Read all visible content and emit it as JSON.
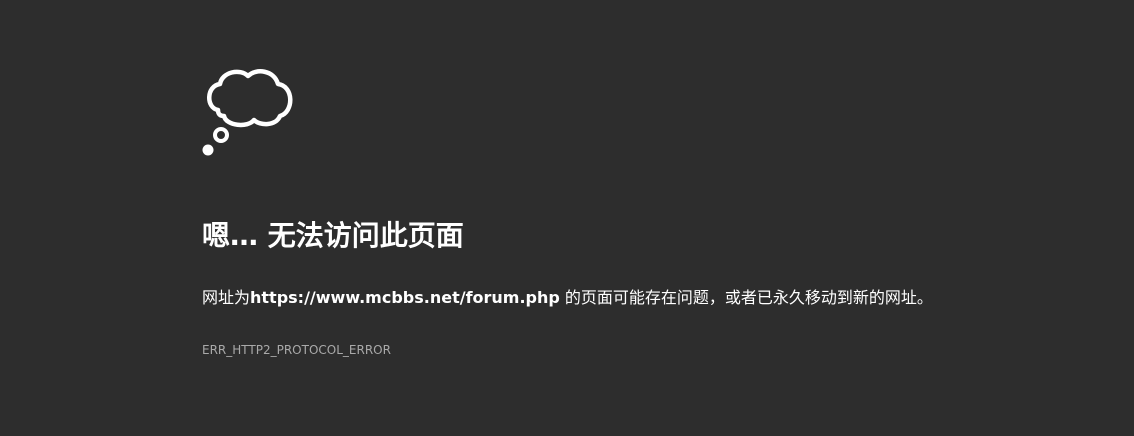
{
  "icon": "thought-cloud-icon",
  "colors": {
    "background": "#2d2d2d",
    "text": "#ffffff",
    "code_text": "#a9a9a9"
  },
  "error": {
    "title": "嗯… 无法访问此页面",
    "message_prefix": "网址为",
    "url": "https://www.mcbbs.net/forum.php",
    "message_suffix": " 的页面可能存在问题，或者已永久移动到新的网址。",
    "code": "ERR_HTTP2_PROTOCOL_ERROR"
  }
}
